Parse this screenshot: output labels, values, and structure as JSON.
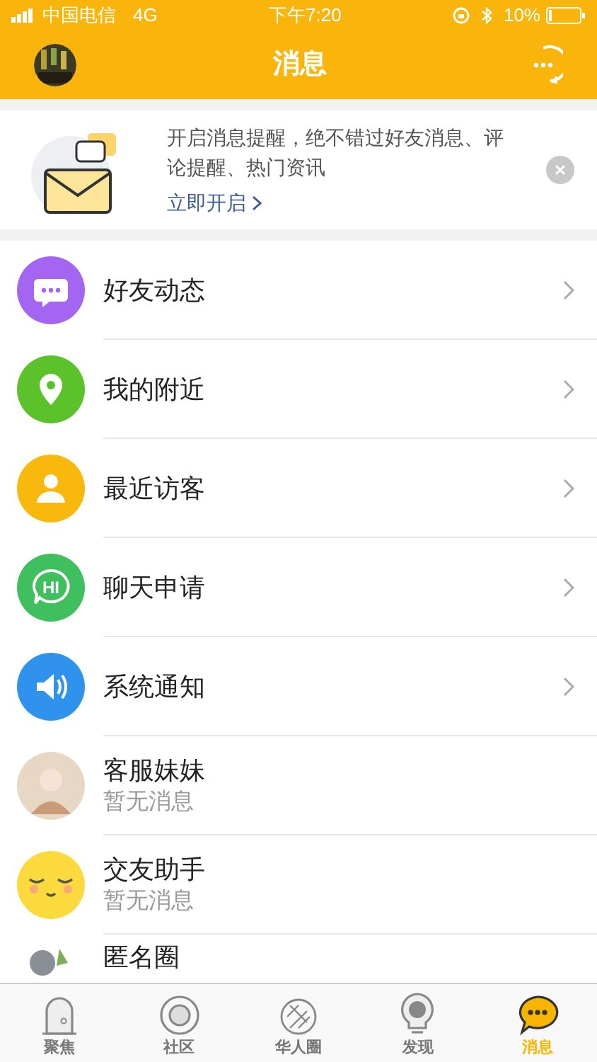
{
  "status_bar": {
    "carrier": "中国电信",
    "network": "4G",
    "time": "下午7:20",
    "battery": "10%"
  },
  "header": {
    "title": "消息"
  },
  "banner": {
    "text": "开启消息提醒，绝不错过好友消息、评论提醒、热门资讯",
    "link": "立即开启"
  },
  "items": [
    {
      "kind": "chat",
      "title": "好友动态",
      "color": "#a466f2"
    },
    {
      "kind": "location",
      "title": "我的附近",
      "color": "#5cc22c"
    },
    {
      "kind": "visitor",
      "title": "最近访客",
      "color": "#f9b80e"
    },
    {
      "kind": "hello",
      "title": "聊天申请",
      "color": "#3fbf5e",
      "badge": "HI"
    },
    {
      "kind": "notice",
      "title": "系统通知",
      "color": "#2f93ee"
    },
    {
      "kind": "service",
      "title": "客服妹妹",
      "subtitle": "暂无消息"
    },
    {
      "kind": "assistant",
      "title": "交友助手",
      "subtitle": "暂无消息"
    },
    {
      "kind": "anonymous",
      "title": "匿名圈"
    }
  ],
  "tabs": [
    {
      "label": "聚焦",
      "selected": false
    },
    {
      "label": "社区",
      "selected": false
    },
    {
      "label": "华人圈",
      "selected": false
    },
    {
      "label": "发现",
      "selected": false
    },
    {
      "label": "消息",
      "selected": true
    }
  ]
}
